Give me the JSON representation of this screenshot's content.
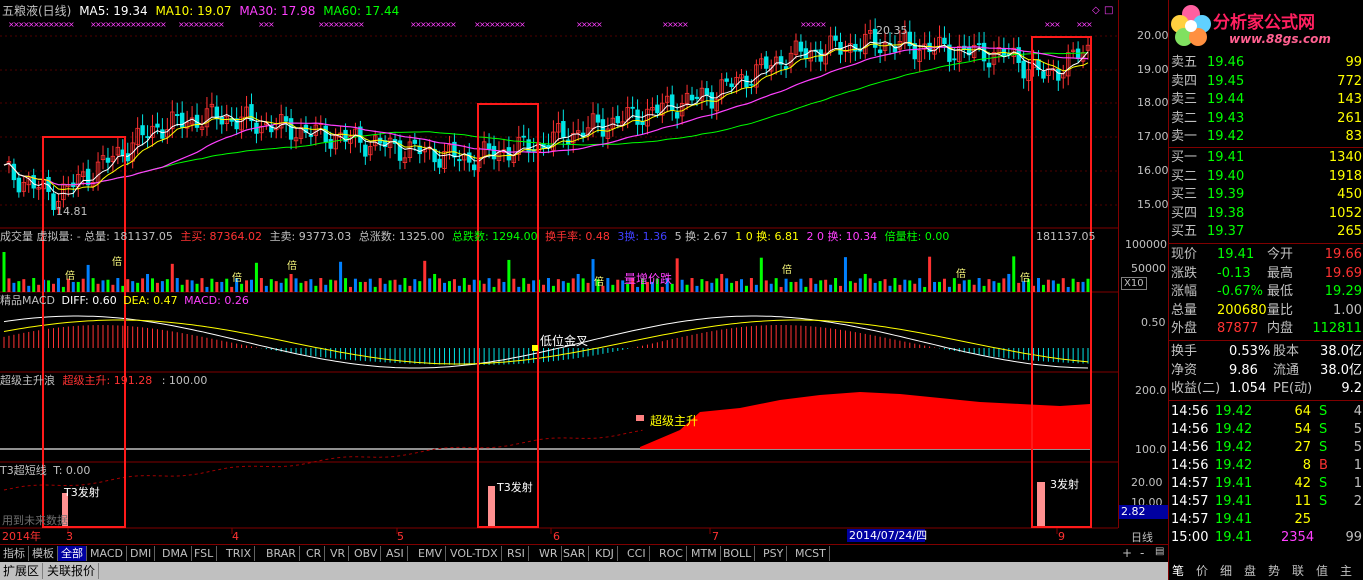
{
  "header": {
    "title": "五粮液(日线)",
    "ma5": "MA5: 19.34",
    "ma10": "MA10: 19.07",
    "ma30": "MA30: 17.98",
    "ma60": "MA60: 17.44",
    "peak_label": "20.35",
    "trough_label": "14.81"
  },
  "price_axis": [
    "20.00",
    "19.00",
    "18.00",
    "17.00",
    "16.00",
    "15.00"
  ],
  "volume_panel": {
    "label": "成交量 虚拟量: -  总量: 181137.05",
    "buy": "主买: 87364.02",
    "sell": "主卖: 93773.03",
    "total_rise": "总涨数: 1325.00",
    "total_fall": "总跌数: 1294.00",
    "turnover": "换手率: 0.48",
    "h3": "3换: 1.36",
    "h5": "5 换: 2.67",
    "h10": "1 0 换: 6.81",
    "h20": "2 0 换: 10.34",
    "bei": "倍量柱: 0.00",
    "vol_value": "181137.05",
    "axis": [
      "100000",
      "50000"
    ],
    "x10": "X10",
    "annotation": "量增价跌",
    "bei_mark": "倍"
  },
  "macd_panel": {
    "name": "精品MACD",
    "diff": "DIFF: 0.60",
    "dea": "DEA: 0.47",
    "macd": "MACD: 0.26",
    "axis": "0.50",
    "annotation": "低位金叉"
  },
  "super_panel": {
    "name": "超级主升浪",
    "value_label": "超级主升: 191.28",
    "value2": ": 100.00",
    "axis": [
      "200.0",
      "100.0"
    ],
    "annotation": "超级主升"
  },
  "t3_panel": {
    "name": "T3超短线",
    "t": "T: 0.00",
    "annotation": "T3发射",
    "annotation3": "3发射",
    "faded": "用到未来数据",
    "axis": [
      "20.00",
      "10.00"
    ],
    "cursor_value": "2.82"
  },
  "x_axis": {
    "year": "2014年",
    "months": [
      "3",
      "4",
      "5",
      "6",
      "7",
      "9"
    ],
    "cursor_date": "2014/07/24/四",
    "period": "日线"
  },
  "tabs": [
    "指标",
    "模板",
    "全部",
    "MACD",
    "DMI",
    "DMA",
    "FSL",
    "TRIX",
    "BRAR",
    "CR",
    "VR",
    "OBV",
    "ASI",
    "EMV",
    "VOL-TDX",
    "RSI",
    "WR",
    "SAR",
    "KDJ",
    "CCI",
    "ROC",
    "MTM",
    "BOLL",
    "PSY",
    "MCST"
  ],
  "bottom_bar": [
    "扩展区",
    "关联报价"
  ],
  "logo": {
    "name": "分析家公式网",
    "url": "www.88gs.com"
  },
  "order_book": {
    "sell": [
      {
        "label": "卖五",
        "price": "19.46",
        "vol": "99"
      },
      {
        "label": "卖四",
        "price": "19.45",
        "vol": "772"
      },
      {
        "label": "卖三",
        "price": "19.44",
        "vol": "143"
      },
      {
        "label": "卖二",
        "price": "19.43",
        "vol": "261"
      },
      {
        "label": "卖一",
        "price": "19.42",
        "vol": "83"
      }
    ],
    "buy": [
      {
        "label": "买一",
        "price": "19.41",
        "vol": "1340"
      },
      {
        "label": "买二",
        "price": "19.40",
        "vol": "1918"
      },
      {
        "label": "买三",
        "price": "19.39",
        "vol": "450"
      },
      {
        "label": "买四",
        "price": "19.38",
        "vol": "1052"
      },
      {
        "label": "买五",
        "price": "19.37",
        "vol": "265"
      }
    ]
  },
  "quote": [
    {
      "l1": "现价",
      "v1": "19.41",
      "l2": "今开",
      "v2": "19.66"
    },
    {
      "l1": "涨跌",
      "v1": "-0.13",
      "l2": "最高",
      "v2": "19.69"
    },
    {
      "l1": "涨幅",
      "v1": "-0.67%",
      "l2": "最低",
      "v2": "19.29"
    },
    {
      "l1": "总量",
      "v1": "200680",
      "l2": "量比",
      "v2": "1.00"
    },
    {
      "l1": "外盘",
      "v1": "87877",
      "l2": "内盘",
      "v2": "112811"
    }
  ],
  "fundamentals": [
    {
      "l1": "换手",
      "v1": "0.53%",
      "l2": "股本",
      "v2": "38.0亿"
    },
    {
      "l1": "净资",
      "v1": "9.86",
      "l2": "流通",
      "v2": "38.0亿"
    },
    {
      "l1": "收益(二)",
      "v1": "1.054",
      "l2": "PE(动)",
      "v2": "9.2"
    }
  ],
  "ticks": [
    {
      "time": "14:56",
      "price": "19.42",
      "vol": "64",
      "side": "S"
    },
    {
      "time": "14:56",
      "price": "19.42",
      "vol": "54",
      "side": "S"
    },
    {
      "time": "14:56",
      "price": "19.42",
      "vol": "27",
      "side": "S"
    },
    {
      "time": "14:56",
      "price": "19.42",
      "vol": "8",
      "side": "B"
    },
    {
      "time": "14:57",
      "price": "19.41",
      "vol": "42",
      "side": "S"
    },
    {
      "time": "14:57",
      "price": "19.41",
      "vol": "11",
      "side": "S"
    },
    {
      "time": "14:57",
      "price": "19.41",
      "vol": "25",
      "side": ""
    },
    {
      "time": "15:00",
      "price": "19.41",
      "vol": "2354",
      "side": ""
    }
  ],
  "tick_extra": [
    "4",
    "5",
    "5",
    "1",
    "1",
    "2",
    "",
    "99"
  ],
  "right_tabs": [
    "笔",
    "价",
    "细",
    "盘",
    "势",
    "联",
    "值",
    "主"
  ],
  "colors": {
    "up": "#ff3232",
    "down": "#00e4e4",
    "ma5": "#ffffff",
    "ma10": "#ffff00",
    "ma30": "#ff40ff",
    "ma60": "#00ff00"
  }
}
